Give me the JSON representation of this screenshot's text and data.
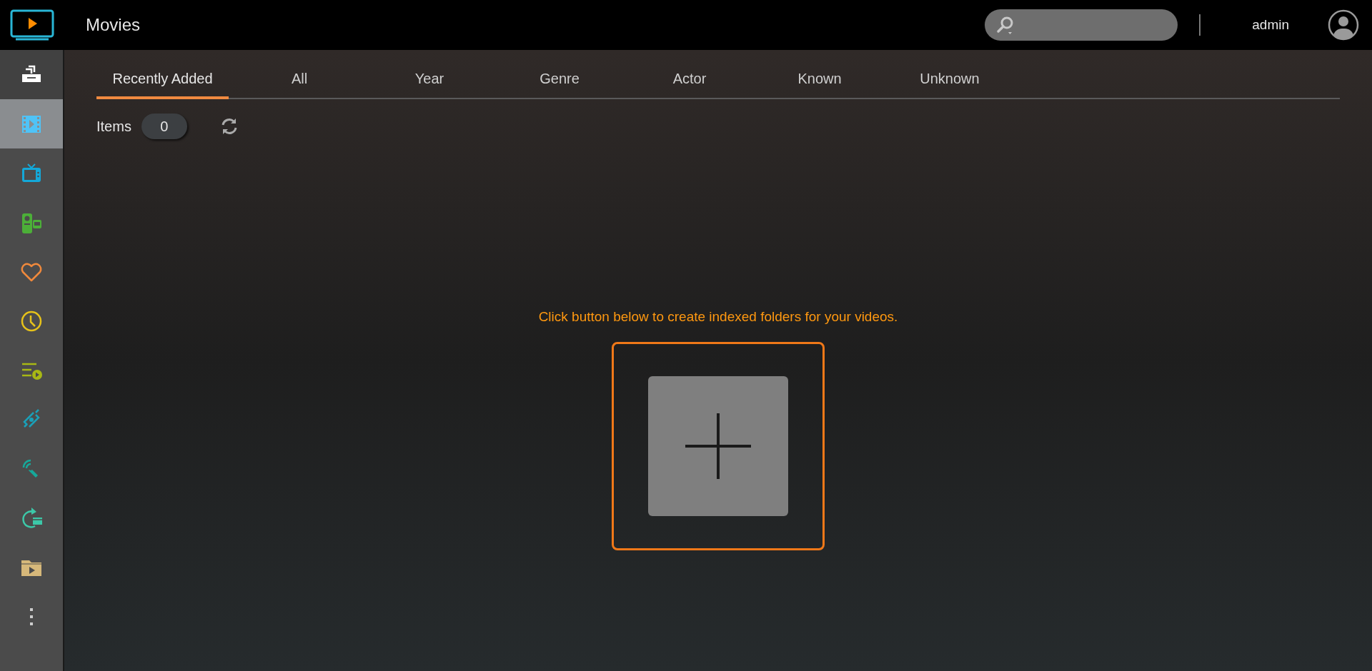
{
  "header": {
    "title": "Movies",
    "user": "admin"
  },
  "sidebar": {
    "items": [
      {
        "kind": "library",
        "selected": false
      },
      {
        "kind": "movies",
        "selected": true
      },
      {
        "kind": "tv",
        "selected": false
      },
      {
        "kind": "homevideo",
        "selected": false
      },
      {
        "kind": "favorites",
        "selected": false
      },
      {
        "kind": "recent",
        "selected": false
      },
      {
        "kind": "playlist",
        "selected": false
      },
      {
        "kind": "link",
        "selected": false
      },
      {
        "kind": "cast",
        "selected": false
      },
      {
        "kind": "convert",
        "selected": false
      },
      {
        "kind": "folder",
        "selected": false
      },
      {
        "kind": "more",
        "selected": false
      }
    ]
  },
  "tabs": [
    {
      "label": "Recently Added",
      "selected": true
    },
    {
      "label": "All",
      "selected": false
    },
    {
      "label": "Year",
      "selected": false
    },
    {
      "label": "Genre",
      "selected": false
    },
    {
      "label": "Actor",
      "selected": false
    },
    {
      "label": "Known",
      "selected": false
    },
    {
      "label": "Unknown",
      "selected": false
    }
  ],
  "items": {
    "label": "Items",
    "count": "0"
  },
  "empty_state": {
    "message": "Click button below to create indexed folders for your videos."
  }
}
